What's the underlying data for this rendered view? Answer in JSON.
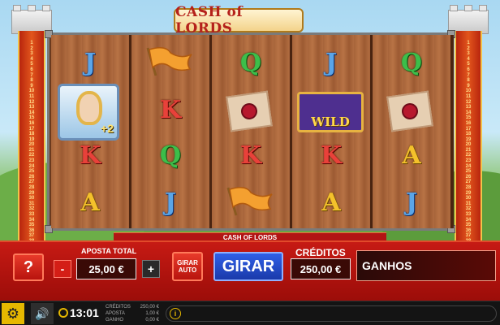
{
  "game": {
    "logo_text": "CASH of LORDS",
    "title_bar": "CASH OF LORDS",
    "paylines": [
      "1",
      "2",
      "3",
      "4",
      "5",
      "6",
      "7",
      "8",
      "9",
      "10",
      "11",
      "12",
      "13",
      "14",
      "15",
      "16",
      "17",
      "18",
      "19",
      "20",
      "21",
      "22",
      "23",
      "24",
      "25",
      "26",
      "27",
      "28",
      "29",
      "30",
      "31",
      "32",
      "33",
      "34",
      "35",
      "36",
      "37",
      "38",
      "39",
      "40"
    ],
    "scatter_badge": "+2",
    "wild_label": "WILD"
  },
  "reels": [
    [
      "J",
      "scatter",
      "K",
      "A"
    ],
    [
      "flag",
      "K",
      "Q",
      "J"
    ],
    [
      "Q",
      "scroll",
      "K",
      "flag"
    ],
    [
      "J",
      "wild",
      "K",
      "A"
    ],
    [
      "Q",
      "scroll",
      "A",
      "J"
    ]
  ],
  "controls": {
    "help_label": "?",
    "minus_label": "-",
    "plus_label": "+",
    "bet_label": "APOSTA TOTAL",
    "bet_value": "25,00 €",
    "auto_label": "GIRAR AUTO",
    "spin_label": "GIRAR",
    "credits_label": "CRÉDITOS",
    "credits_value": "250,00 €",
    "win_label": "GANHOS"
  },
  "status_bar": {
    "clock": "13:01",
    "stats": [
      {
        "label": "CRÉDITOS",
        "value": "250,00 €"
      },
      {
        "label": "APOSTA",
        "value": "1,00 €"
      },
      {
        "label": "GANHO",
        "value": "0,00 €"
      }
    ],
    "info_icon": "i"
  },
  "icons": {
    "settings": "gear-icon",
    "sound": "speaker-icon",
    "clock": "clock-icon",
    "info": "info-icon"
  },
  "colors": {
    "panel_red": "#c61a14",
    "spin_blue": "#2a50d8",
    "accent_yellow": "#e6b800"
  }
}
